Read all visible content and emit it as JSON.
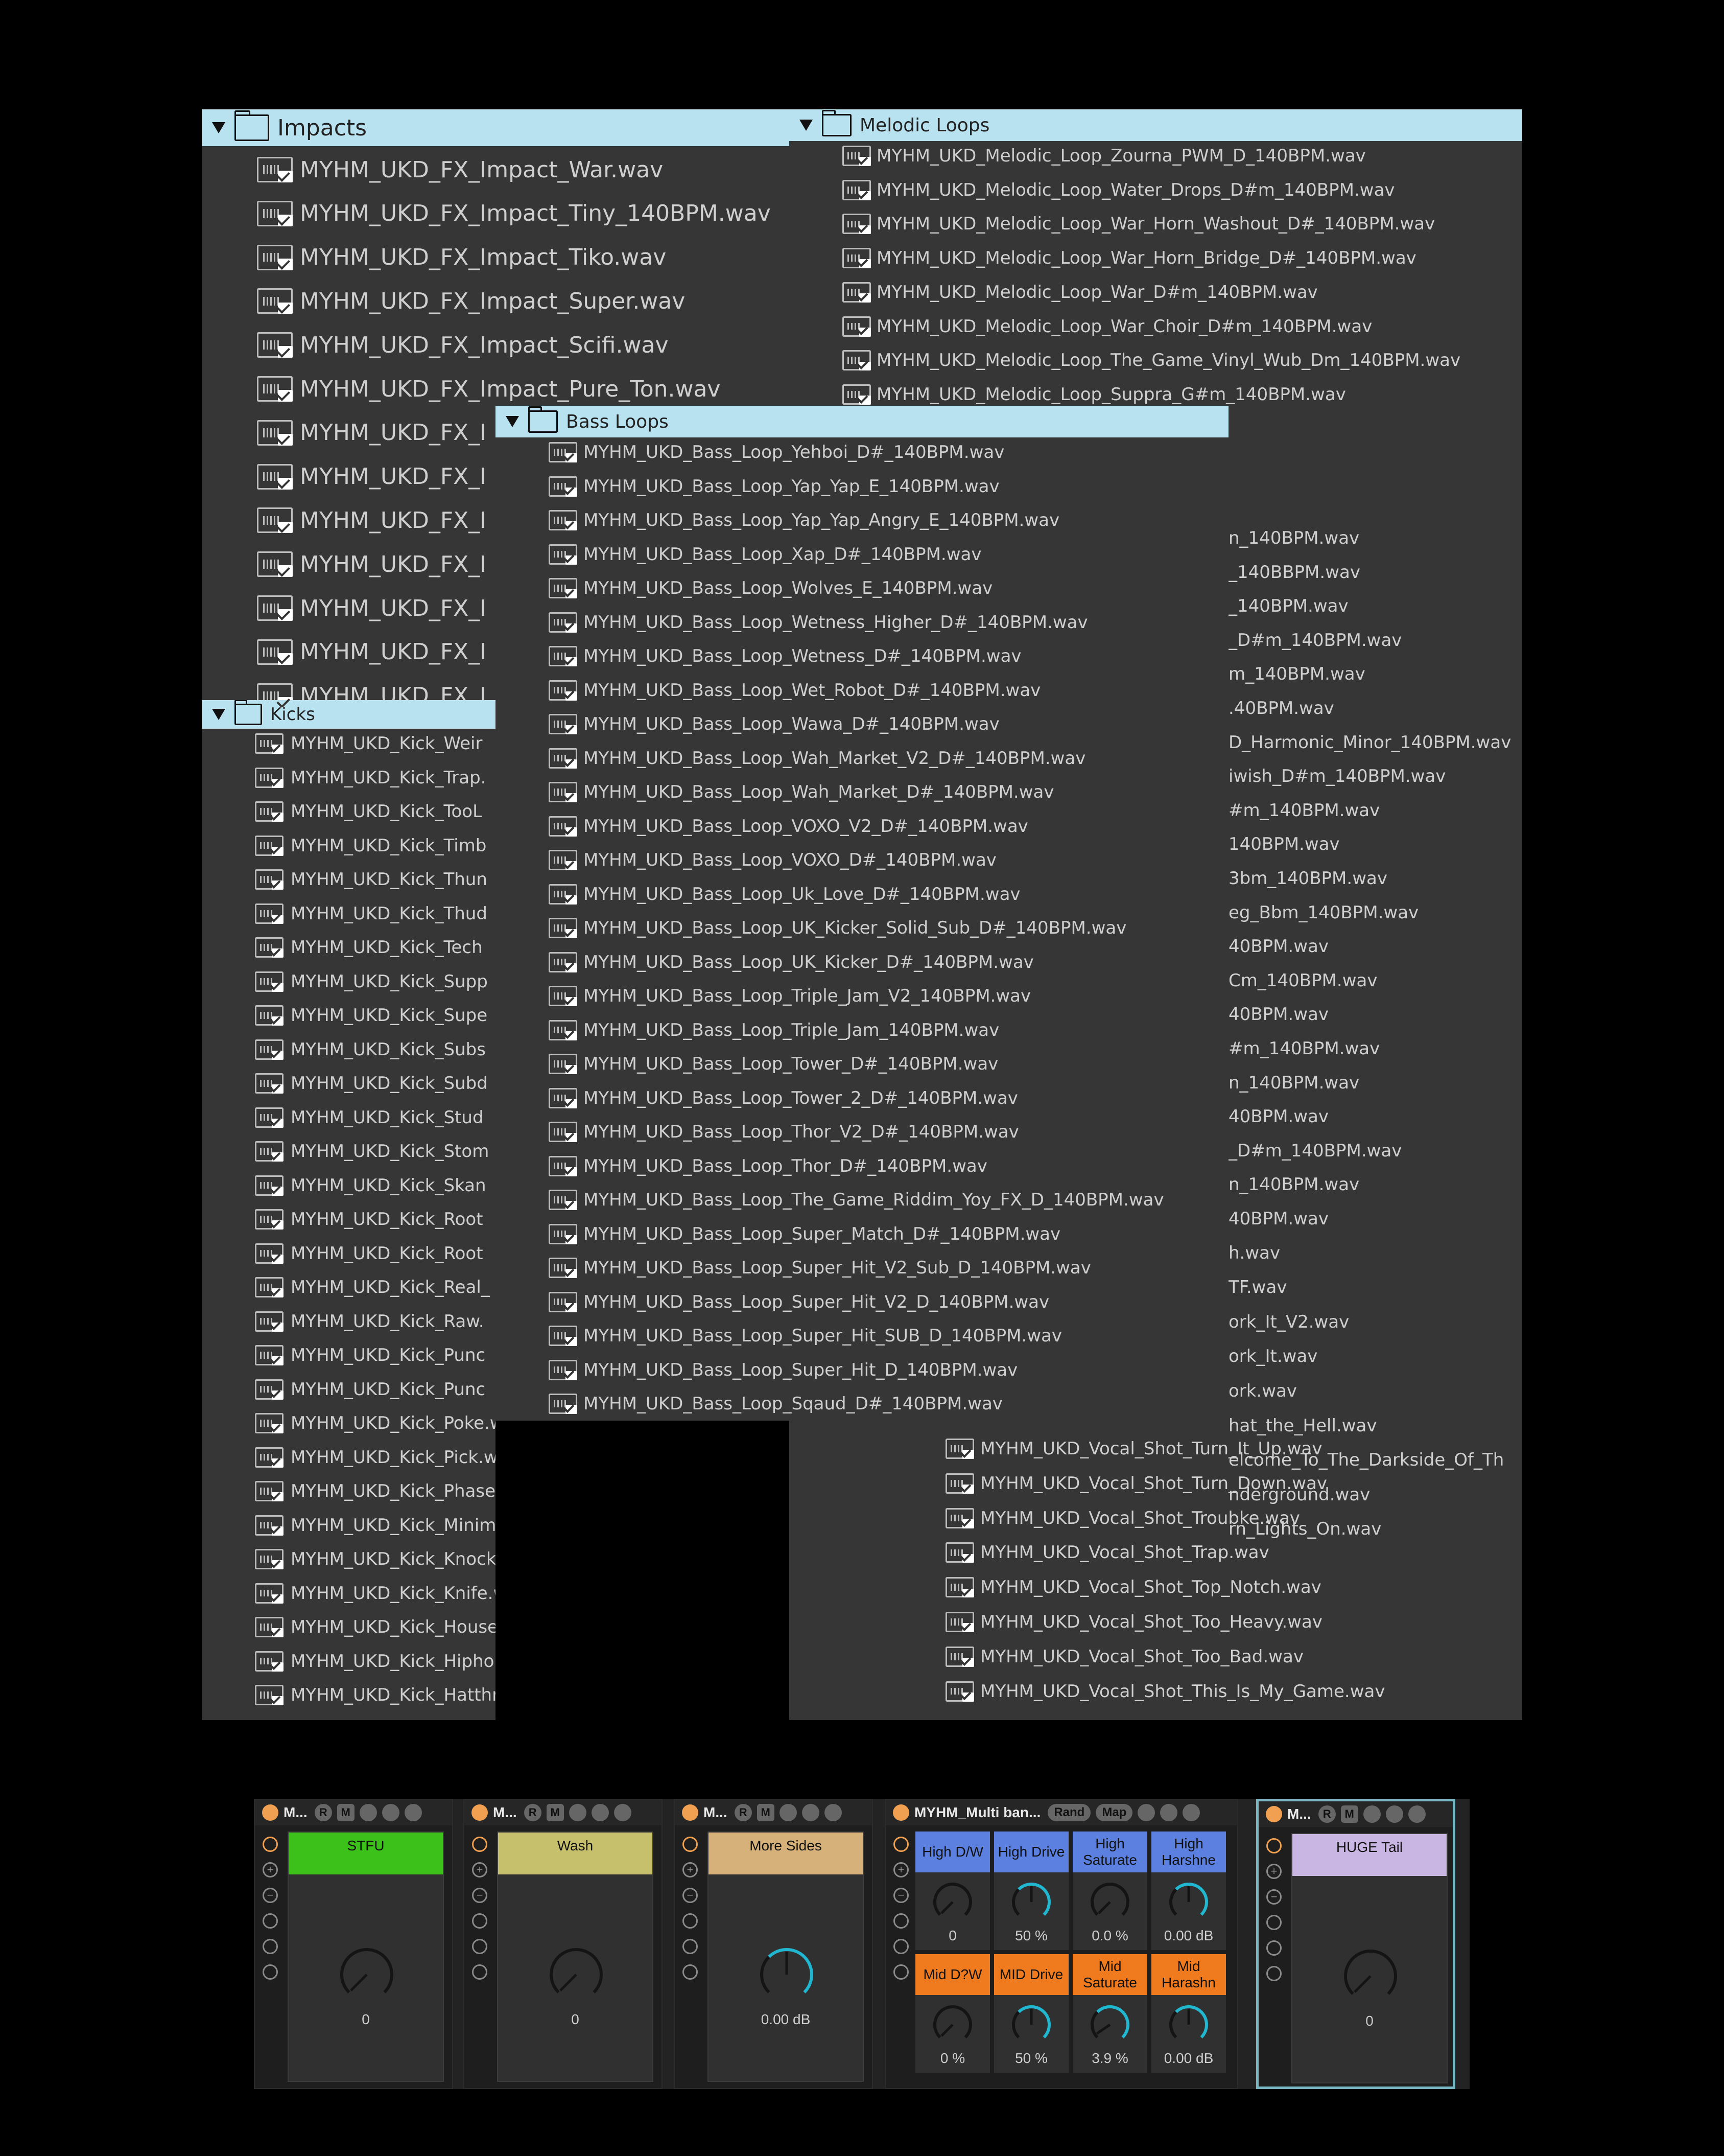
{
  "impacts": {
    "title": "Impacts",
    "items": [
      "MYHM_UKD_FX_Impact_War.wav",
      "MYHM_UKD_FX_Impact_Tiny_140BPM.wav",
      "MYHM_UKD_FX_Impact_Tiko.wav",
      "MYHM_UKD_FX_Impact_Super.wav",
      "MYHM_UKD_FX_Impact_Scifi.wav",
      "MYHM_UKD_FX_Impact_Pure_Ton.wav",
      "MYHM_UKD_FX_I",
      "MYHM_UKD_FX_I",
      "MYHM_UKD_FX_I",
      "MYHM_UKD_FX_I",
      "MYHM_UKD_FX_I",
      "MYHM_UKD_FX_I",
      "MYHM_UKD_FX_I"
    ]
  },
  "melodic": {
    "title": "Melodic Loops",
    "items": [
      "MYHM_UKD_Melodic_Loop_Zourna_PWM_D_140BPM.wav",
      "MYHM_UKD_Melodic_Loop_Water_Drops_D#m_140BPM.wav",
      "MYHM_UKD_Melodic_Loop_War_Horn_Washout_D#_140BPM.wav",
      "MYHM_UKD_Melodic_Loop_War_Horn_Bridge_D#_140BPM.wav",
      "MYHM_UKD_Melodic_Loop_War_D#m_140BPM.wav",
      "MYHM_UKD_Melodic_Loop_War_Choir_D#m_140BPM.wav",
      "MYHM_UKD_Melodic_Loop_The_Game_Vinyl_Wub_Dm_140BPM.wav",
      "MYHM_UKD_Melodic_Loop_Suppra_G#m_140BPM.wav"
    ],
    "fragments": [
      "n_140BPM.wav",
      "_140BBPM.wav",
      "_140BPM.wav",
      "_D#m_140BPM.wav",
      "m_140BPM.wav",
      ".40BPM.wav",
      "D_Harmonic_Minor_140BPM.wav",
      "iwish_D#m_140BPM.wav",
      "#m_140BPM.wav",
      "140BPM.wav",
      "3bm_140BPM.wav",
      "eg_Bbm_140BPM.wav",
      "40BPM.wav",
      "Cm_140BPM.wav",
      "40BPM.wav",
      "#m_140BPM.wav",
      "n_140BPM.wav",
      "40BPM.wav",
      "_D#m_140BPM.wav",
      "n_140BPM.wav",
      "40BPM.wav",
      "h.wav",
      "TF.wav",
      "ork_It_V2.wav",
      "ork_It.wav",
      "ork.wav",
      "hat_the_Hell.wav",
      "elcome_To_The_Darkside_Of_Th",
      "nderground.wav",
      "rn_Lights_On.wav"
    ]
  },
  "vocals": {
    "items": [
      "MYHM_UKD_Vocal_Shot_Turn_It_Up.wav",
      "MYHM_UKD_Vocal_Shot_Turn_Down.wav",
      "MYHM_UKD_Vocal_Shot_Troubke.wav",
      "MYHM_UKD_Vocal_Shot_Trap.wav",
      "MYHM_UKD_Vocal_Shot_Top_Notch.wav",
      "MYHM_UKD_Vocal_Shot_Too_Heavy.wav",
      "MYHM_UKD_Vocal_Shot_Too_Bad.wav",
      "MYHM_UKD_Vocal_Shot_This_Is_My_Game.wav"
    ]
  },
  "bass": {
    "title": "Bass Loops",
    "items": [
      "MYHM_UKD_Bass_Loop_Yehboi_D#_140BPM.wav",
      "MYHM_UKD_Bass_Loop_Yap_Yap_E_140BPM.wav",
      "MYHM_UKD_Bass_Loop_Yap_Yap_Angry_E_140BPM.wav",
      "MYHM_UKD_Bass_Loop_Xap_D#_140BPM.wav",
      "MYHM_UKD_Bass_Loop_Wolves_E_140BPM.wav",
      "MYHM_UKD_Bass_Loop_Wetness_Higher_D#_140BPM.wav",
      "MYHM_UKD_Bass_Loop_Wetness_D#_140BPM.wav",
      "MYHM_UKD_Bass_Loop_Wet_Robot_D#_140BPM.wav",
      "MYHM_UKD_Bass_Loop_Wawa_D#_140BPM.wav",
      "MYHM_UKD_Bass_Loop_Wah_Market_V2_D#_140BPM.wav",
      "MYHM_UKD_Bass_Loop_Wah_Market_D#_140BPM.wav",
      "MYHM_UKD_Bass_Loop_VOXO_V2_D#_140BPM.wav",
      "MYHM_UKD_Bass_Loop_VOXO_D#_140BPM.wav",
      "MYHM_UKD_Bass_Loop_Uk_Love_D#_140BPM.wav",
      "MYHM_UKD_Bass_Loop_UK_Kicker_Solid_Sub_D#_140BPM.wav",
      "MYHM_UKD_Bass_Loop_UK_Kicker_D#_140BPM.wav",
      "MYHM_UKD_Bass_Loop_Triple_Jam_V2_140BPM.wav",
      "MYHM_UKD_Bass_Loop_Triple_Jam_140BPM.wav",
      "MYHM_UKD_Bass_Loop_Tower_D#_140BPM.wav",
      "MYHM_UKD_Bass_Loop_Tower_2_D#_140BPM.wav",
      "MYHM_UKD_Bass_Loop_Thor_V2_D#_140BPM.wav",
      "MYHM_UKD_Bass_Loop_Thor_D#_140BPM.wav",
      "MYHM_UKD_Bass_Loop_The_Game_Riddim_Yoy_FX_D_140BPM.wav",
      "MYHM_UKD_Bass_Loop_Super_Match_D#_140BPM.wav",
      "MYHM_UKD_Bass_Loop_Super_Hit_V2_Sub_D_140BPM.wav",
      "MYHM_UKD_Bass_Loop_Super_Hit_V2_D_140BPM.wav",
      "MYHM_UKD_Bass_Loop_Super_Hit_SUB_D_140BPM.wav",
      "MYHM_UKD_Bass_Loop_Super_Hit_D_140BPM.wav",
      "MYHM_UKD_Bass_Loop_Sqaud_D#_140BPM.wav"
    ]
  },
  "kicks": {
    "title": "Kicks",
    "items": [
      "MYHM_UKD_Kick_Weir",
      "MYHM_UKD_Kick_Trap.",
      "MYHM_UKD_Kick_TooL",
      "MYHM_UKD_Kick_Timb",
      "MYHM_UKD_Kick_Thun",
      "MYHM_UKD_Kick_Thud",
      "MYHM_UKD_Kick_Tech",
      "MYHM_UKD_Kick_Supp",
      "MYHM_UKD_Kick_Supe",
      "MYHM_UKD_Kick_Subs",
      "MYHM_UKD_Kick_Subd",
      "MYHM_UKD_Kick_Stud",
      "MYHM_UKD_Kick_Stom",
      "MYHM_UKD_Kick_Skan",
      "MYHM_UKD_Kick_Root",
      "MYHM_UKD_Kick_Root",
      "MYHM_UKD_Kick_Real_",
      "MYHM_UKD_Kick_Raw.",
      "MYHM_UKD_Kick_Punc",
      "MYHM_UKD_Kick_Punc",
      "MYHM_UKD_Kick_Poke.wav",
      "MYHM_UKD_Kick_Pick.wav",
      "MYHM_UKD_Kick_Phase.wav",
      "MYHM_UKD_Kick_Minimal.wav",
      "MYHM_UKD_Kick_Knock.wav",
      "MYHM_UKD_Kick_Knife.wav",
      "MYHM_UKD_Kick_House.wav",
      "MYHM_UKD_Kick_Hiphop.wav",
      "MYHM_UKD_Kick_Hatthree.wav"
    ]
  },
  "rack": {
    "devices": [
      {
        "title": "M...",
        "buttons": [
          "R",
          "M"
        ],
        "macro_label": "STFU",
        "macro_color": "#3cc11b",
        "value": "0",
        "amount": 0
      },
      {
        "title": "M...",
        "buttons": [
          "R",
          "M"
        ],
        "macro_label": "Wash",
        "macro_color": "#c6c06c",
        "value": "0",
        "amount": 0
      },
      {
        "title": "M...",
        "buttons": [
          "R",
          "M"
        ],
        "macro_label": "More Sides",
        "macro_color": "#d6b27a",
        "value": "0.00 dB",
        "amount": 0.5
      },
      {
        "title": "MYHM_Multi ban...",
        "buttons": [
          "Rand",
          "Map"
        ],
        "macros": [
          {
            "label": "High D/W",
            "color": "#5b80e0",
            "value": "0",
            "amount": 0
          },
          {
            "label": "High Drive",
            "color": "#5b80e0",
            "value": "50 %",
            "amount": 0.5
          },
          {
            "label": "High Saturate",
            "color": "#5b80e0",
            "value": "0.0 %",
            "amount": 0
          },
          {
            "label": "High Harshne",
            "color": "#5b80e0",
            "value": "0.00 dB",
            "amount": 0.5
          },
          {
            "label": "Mid D?W",
            "color": "#f07a1e",
            "value": "0 %",
            "amount": 0
          },
          {
            "label": "MID Drive",
            "color": "#f07a1e",
            "value": "50 %",
            "amount": 0.5
          },
          {
            "label": "Mid Saturate",
            "color": "#f07a1e",
            "value": "3.9 %",
            "amount": 0.04
          },
          {
            "label": "Mid Harashn",
            "color": "#f07a1e",
            "value": "0.00 dB",
            "amount": 0.5
          }
        ]
      },
      {
        "title": "M...",
        "buttons": [
          "R",
          "M"
        ],
        "macro_label": "HUGE Tail",
        "macro_color": "#c9b6e2",
        "value": "0",
        "amount": 0
      }
    ]
  }
}
